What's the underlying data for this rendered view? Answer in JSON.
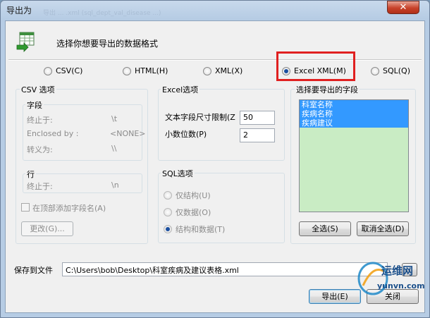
{
  "window": {
    "title": "导出为",
    "close_glyph": "✕",
    "ghost_text": "导出 ... .xml   (sql_dept_val_disease  ...)"
  },
  "header": {
    "text": "选择你想要导出的数据格式",
    "icon": "table-export-icon"
  },
  "formats": [
    {
      "label": "CSV(C)",
      "checked": false
    },
    {
      "label": "HTML(H)",
      "checked": false
    },
    {
      "label": "XML(X)",
      "checked": false
    },
    {
      "label": "Excel XML(M)",
      "checked": true
    },
    {
      "label": "SQL(Q)",
      "checked": false
    }
  ],
  "csv": {
    "title": "CSV 选项",
    "field_title": "字段",
    "terminated_label": "终止于:",
    "terminated_value": "\\t",
    "enclosed_label": "Enclosed by :",
    "enclosed_value": "<NONE>",
    "escaped_label": "转义为:",
    "escaped_value": "\\\\",
    "row_title": "行",
    "row_terminated_label": "终止于:",
    "row_terminated_value": "\\n",
    "add_header_label": "在顶部添加字段名(A)",
    "change_button": "更改(G)..."
  },
  "excel": {
    "title": "Excel选项",
    "text_size_label": "文本字段尺寸限制(Z)",
    "text_size_value": "50",
    "decimal_label": "小数位数(P)",
    "decimal_value": "2"
  },
  "sql": {
    "title": "SQL选项",
    "options": [
      {
        "label": "仅结构(U)",
        "checked": false
      },
      {
        "label": "仅数据(O)",
        "checked": false
      },
      {
        "label": "结构和数据(T)",
        "checked": true
      }
    ]
  },
  "fields": {
    "title": "选择要导出的字段",
    "items": [
      "科室名称",
      "疾病名称",
      "疾病建议"
    ],
    "select_all": "全选(S)",
    "deselect_all": "取消全选(D)"
  },
  "save": {
    "label": "保存到文件",
    "path": "C:\\Users\\bob\\Desktop\\科室疾病及建议表格.xml",
    "browse": "..."
  },
  "buttons": {
    "export": "导出(E)",
    "close": "关闭"
  },
  "watermark": {
    "brand": "运维网",
    "url": "yunvn.com"
  },
  "colors": {
    "highlight": "#e02020",
    "selection": "#3399ff",
    "listbox_bg": "#c9ecc4"
  }
}
